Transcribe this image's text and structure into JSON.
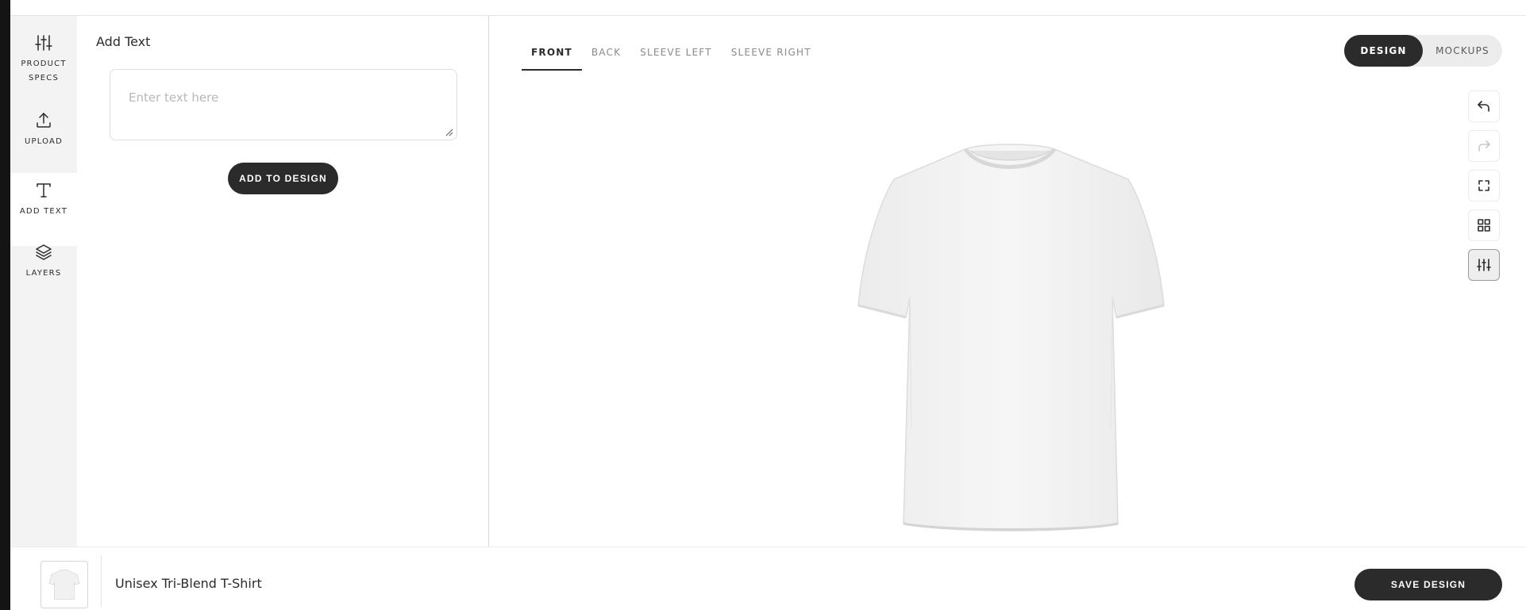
{
  "sidebar": {
    "items": [
      {
        "label_line1": "PRODUCT",
        "label_line2": "SPECS",
        "icon": "sliders-icon"
      },
      {
        "label": "UPLOAD",
        "icon": "upload-icon"
      },
      {
        "label": "ADD TEXT",
        "icon": "text-icon"
      },
      {
        "label": "LAYERS",
        "icon": "layers-icon"
      }
    ]
  },
  "panel": {
    "title": "Add Text",
    "text_placeholder": "Enter text here",
    "text_value": "",
    "add_button": "ADD TO DESIGN"
  },
  "canvas": {
    "tabs": [
      {
        "label": "FRONT",
        "active": true
      },
      {
        "label": "BACK"
      },
      {
        "label": "SLEEVE LEFT"
      },
      {
        "label": "SLEEVE RIGHT"
      }
    ],
    "toggle": {
      "design": "DESIGN",
      "mockups": "MOCKUPS",
      "selected": "DESIGN"
    },
    "tools": [
      "undo-icon",
      "redo-icon",
      "fullscreen-icon",
      "grid-icon",
      "sliders-icon"
    ]
  },
  "bottom": {
    "product_name": "Unisex Tri-Blend T-Shirt",
    "save_button": "SAVE DESIGN"
  },
  "colors": {
    "primary": "#2b2b2b",
    "sidebar_bg": "#f3f3f3"
  }
}
